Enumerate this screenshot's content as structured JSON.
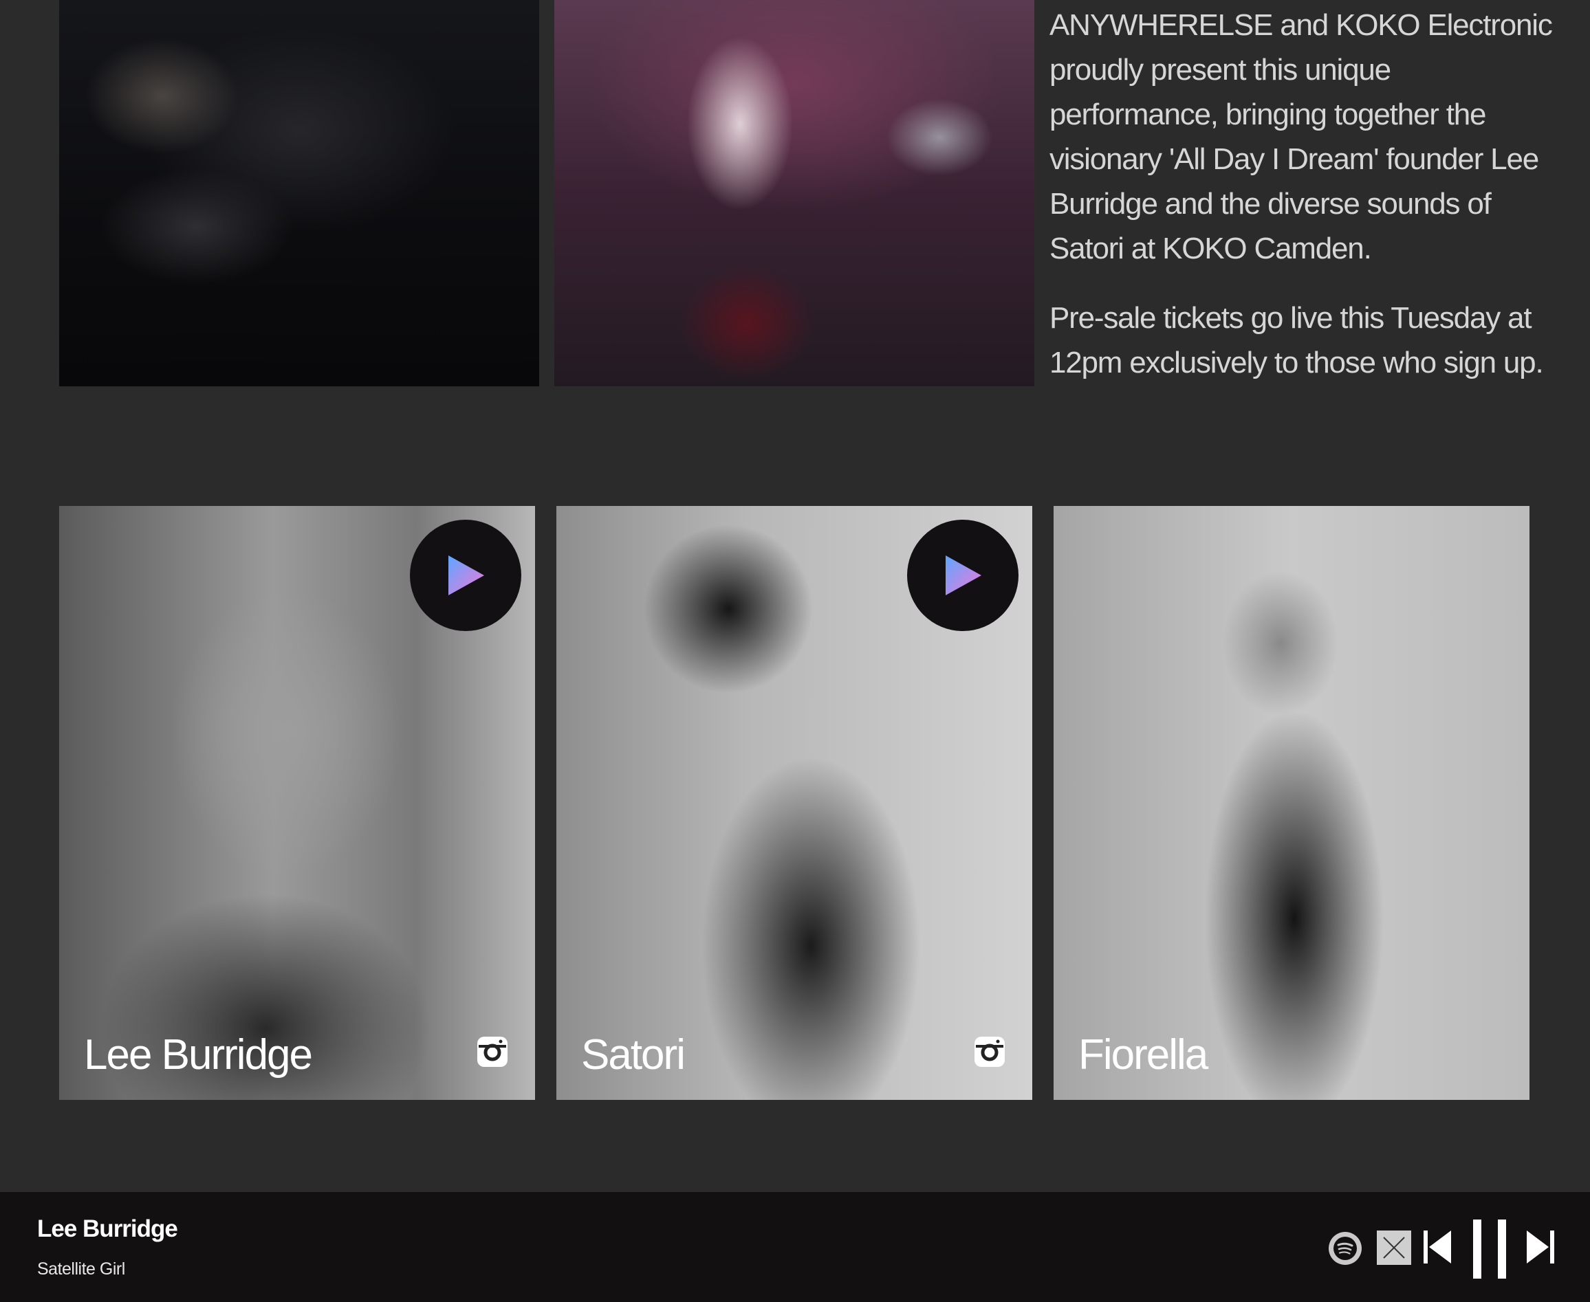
{
  "blurb": {
    "paragraph_1": "ANYWHERELSE and KOKO Electronic proudly present this unique performance, bringing together the visionary 'All Day I Dream' founder Lee Burridge and the diverse sounds of Satori at KOKO Camden.",
    "paragraph_2": "Pre-sale tickets go live this Tuesday at 12pm exclusively to those who sign up."
  },
  "artists": [
    {
      "name": "Lee Burridge",
      "has_play": true,
      "has_instagram": true
    },
    {
      "name": "Satori",
      "has_play": true,
      "has_instagram": true
    },
    {
      "name": "Fiorella",
      "has_play": false,
      "has_instagram": false
    }
  ],
  "player": {
    "artist": "Lee Burridge",
    "track": "Satellite Girl",
    "controls": [
      "spotify-icon",
      "close-icon",
      "previous-icon",
      "pause-icon",
      "next-icon"
    ]
  },
  "colors": {
    "background": "#2b2b2b",
    "player_bar": "#131012",
    "play_gradient_start": "#5ea6ff",
    "play_gradient_end": "#f07ad8"
  }
}
